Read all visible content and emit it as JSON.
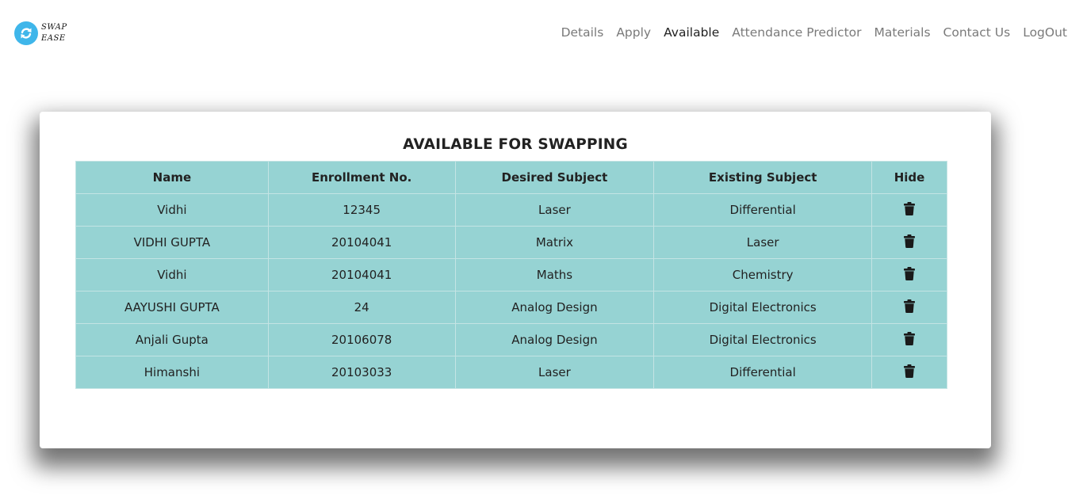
{
  "logo": {
    "line1": "SWAP",
    "line2": "EASE",
    "icon": "swap-arrows-icon",
    "color": "#3fb6ea"
  },
  "nav": {
    "items": [
      {
        "label": "Details"
      },
      {
        "label": "Apply"
      },
      {
        "label": "Available",
        "active": true
      },
      {
        "label": "Attendance Predictor"
      },
      {
        "label": "Materials"
      },
      {
        "label": "Contact Us"
      },
      {
        "label": "LogOut"
      }
    ]
  },
  "main": {
    "title": "AVAILABLE FOR SWAPPING",
    "table_color": "#96d3d3",
    "headers": [
      "Name",
      "Enrollment No.",
      "Desired Subject",
      "Existing Subject",
      "Hide"
    ],
    "rows": [
      [
        "Vidhi",
        "12345",
        "Laser",
        "Differential"
      ],
      [
        "VIDHI GUPTA",
        "20104041",
        "Matrix",
        "Laser"
      ],
      [
        "Vidhi",
        "20104041",
        "Maths",
        "Chemistry"
      ],
      [
        "AAYUSHI GUPTA",
        "24",
        "Analog Design",
        "Digital Electronics"
      ],
      [
        "Anjali Gupta",
        "20106078",
        "Analog Design",
        "Digital Electronics"
      ],
      [
        "Himanshi",
        "20103033",
        "Laser",
        "Differential"
      ]
    ],
    "hide_icon": "trash-icon"
  }
}
